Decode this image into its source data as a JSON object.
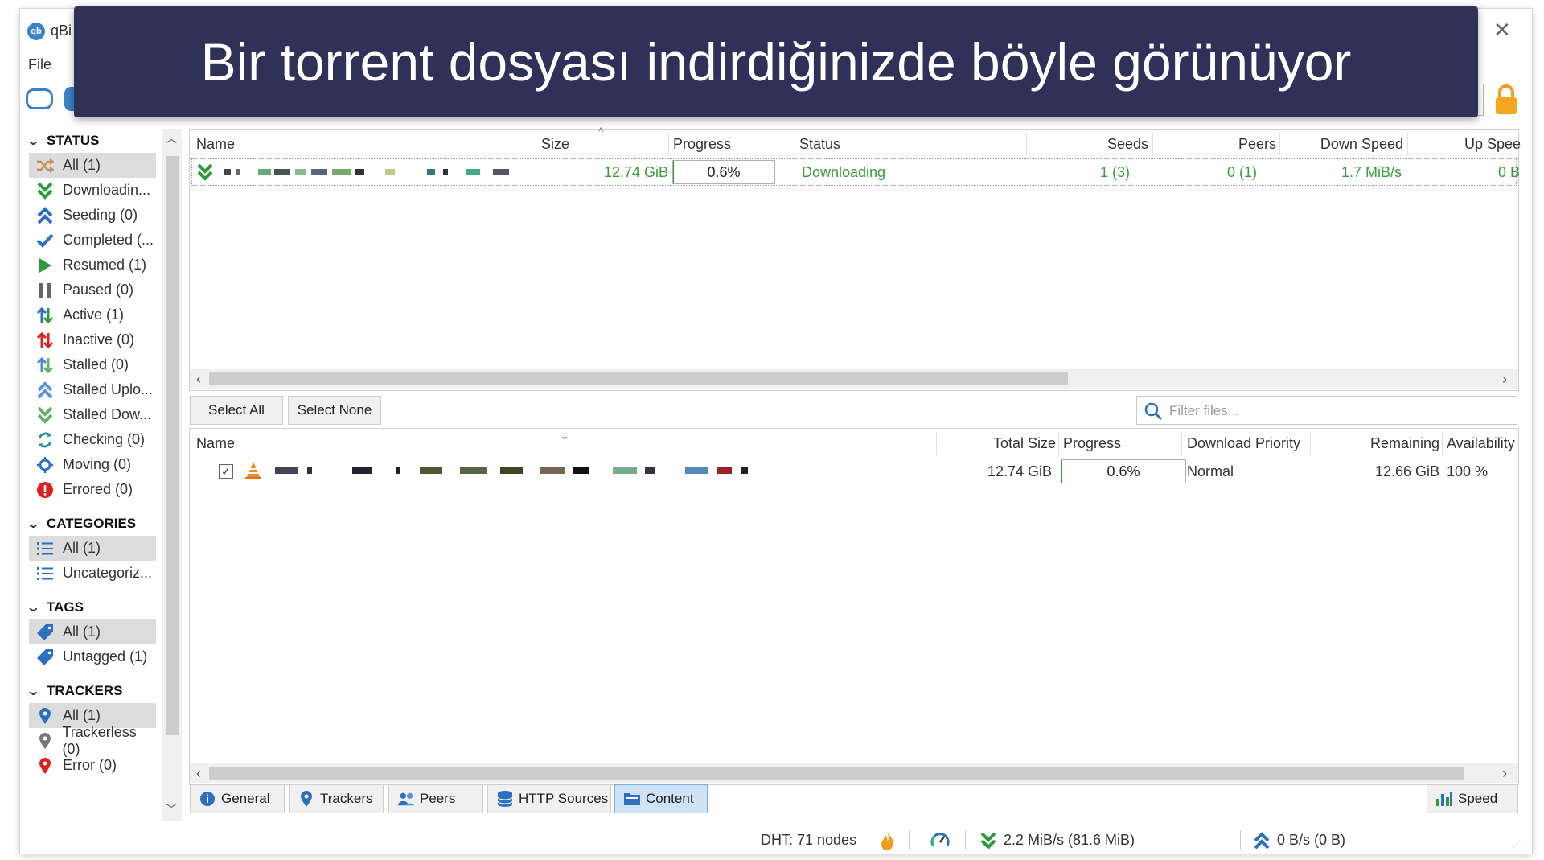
{
  "banner": {
    "text": "Bir torrent dosyası indirdiğinizde böyle görünüyor"
  },
  "window": {
    "title": "qBi",
    "menu_file": "File"
  },
  "sidebar": {
    "status_header": "STATUS",
    "status_items": [
      {
        "label": "All (1)",
        "icon": "shuffle-icon"
      },
      {
        "label": "Downloadin...",
        "icon": "download-icon"
      },
      {
        "label": "Seeding (0)",
        "icon": "upload-icon"
      },
      {
        "label": "Completed (...",
        "icon": "check-icon"
      },
      {
        "label": "Resumed (1)",
        "icon": "play-icon"
      },
      {
        "label": "Paused (0)",
        "icon": "pause-icon"
      },
      {
        "label": "Active (1)",
        "icon": "active-icon"
      },
      {
        "label": "Inactive (0)",
        "icon": "inactive-icon"
      },
      {
        "label": "Stalled (0)",
        "icon": "stalled-icon"
      },
      {
        "label": "Stalled Uplo...",
        "icon": "stalled-upload-icon"
      },
      {
        "label": "Stalled Dow...",
        "icon": "stalled-download-icon"
      },
      {
        "label": "Checking (0)",
        "icon": "checking-icon"
      },
      {
        "label": "Moving (0)",
        "icon": "moving-icon"
      },
      {
        "label": "Errored (0)",
        "icon": "error-icon"
      }
    ],
    "categories_header": "CATEGORIES",
    "categories_items": [
      {
        "label": "All (1)",
        "icon": "list-icon"
      },
      {
        "label": "Uncategoriz...",
        "icon": "list-icon"
      }
    ],
    "tags_header": "TAGS",
    "tags_items": [
      {
        "label": "All (1)",
        "icon": "tag-icon"
      },
      {
        "label": "Untagged (1)",
        "icon": "tag-icon"
      }
    ],
    "trackers_header": "TRACKERS",
    "trackers_items": [
      {
        "label": "All (1)",
        "icon": "pin-icon"
      },
      {
        "label": "Trackerless (0)",
        "icon": "pin-icon"
      },
      {
        "label": "Error (0)",
        "icon": "pin-icon"
      }
    ]
  },
  "torrent_table": {
    "columns": [
      "Name",
      "Size",
      "Progress",
      "Status",
      "Seeds",
      "Peers",
      "Down Speed",
      "Up Spee"
    ],
    "row": {
      "size": "12.74 GiB",
      "progress": "0.6%",
      "progress_value": 0.006,
      "status": "Downloading",
      "seeds": "1 (3)",
      "peers": "0 (1)",
      "down_speed": "1.7 MiB/s",
      "up_speed": "0 B"
    }
  },
  "content_toolbar": {
    "select_all": "Select All",
    "select_none": "Select None",
    "filter_placeholder": "Filter files..."
  },
  "files_table": {
    "columns": [
      "Name",
      "Total Size",
      "Progress",
      "Download Priority",
      "Remaining",
      "Availability"
    ],
    "row": {
      "total_size": "12.74 GiB",
      "progress": "0.6%",
      "progress_value": 0.006,
      "priority": "Normal",
      "remaining": "12.66 GiB",
      "availability": "100 %"
    }
  },
  "bottom_tabs": [
    {
      "label": "General",
      "icon": "info-icon"
    },
    {
      "label": "Trackers",
      "icon": "pin-icon"
    },
    {
      "label": "Peers",
      "icon": "peers-icon"
    },
    {
      "label": "HTTP Sources",
      "icon": "database-icon"
    },
    {
      "label": "Content",
      "icon": "folder-icon"
    }
  ],
  "speed_button": "Speed",
  "statusbar": {
    "dht": "DHT: 71 nodes",
    "down": "2.2 MiB/s (81.6 MiB)",
    "up": "0 B/s (0 B)"
  },
  "colors": {
    "accent": "#2f3159",
    "status_green": "#3a9a3a",
    "progress_border": "#b0b0b0"
  }
}
